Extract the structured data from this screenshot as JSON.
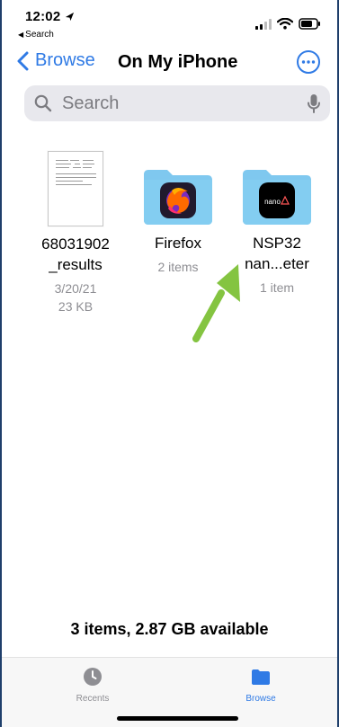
{
  "status_bar": {
    "time": "12:02",
    "back_app": "Search",
    "location_icon": "location-arrow-icon",
    "signal_icon": "signal-bars-icon",
    "wifi_icon": "wifi-icon",
    "battery_icon": "battery-icon"
  },
  "nav": {
    "back_label": "Browse",
    "title": "On My iPhone",
    "back_icon": "chevron-left-icon",
    "more_icon": "ellipsis-circle-icon"
  },
  "search": {
    "placeholder": "Search",
    "value": "",
    "search_icon": "magnifying-glass-icon",
    "mic_icon": "microphone-icon"
  },
  "files": [
    {
      "name": "68031902\n_results",
      "meta": "3/20/21\n23 KB",
      "type": "document",
      "icon": "document-thumbnail-icon"
    },
    {
      "name": "Firefox",
      "meta": "2 items",
      "type": "folder",
      "icon": "firefox-folder-icon",
      "app_color": "#7b2cbf"
    },
    {
      "name": "NSP32\nnan...eter",
      "meta": "1 item",
      "type": "folder",
      "icon": "nano-folder-icon",
      "app_label": "nano"
    }
  ],
  "annotation": {
    "icon": "green-arrow-icon",
    "color": "#84c441"
  },
  "footer": {
    "storage": "3 items, 2.87 GB available"
  },
  "tab_bar": {
    "items": [
      {
        "label": "Recents",
        "icon": "clock-icon",
        "active": false
      },
      {
        "label": "Browse",
        "icon": "folder-icon",
        "active": true
      }
    ]
  },
  "colors": {
    "accent": "#2f7ae5",
    "folder": "#7fc8ef",
    "folder_dark": "#4ea9df",
    "muted": "#8e8e93"
  }
}
